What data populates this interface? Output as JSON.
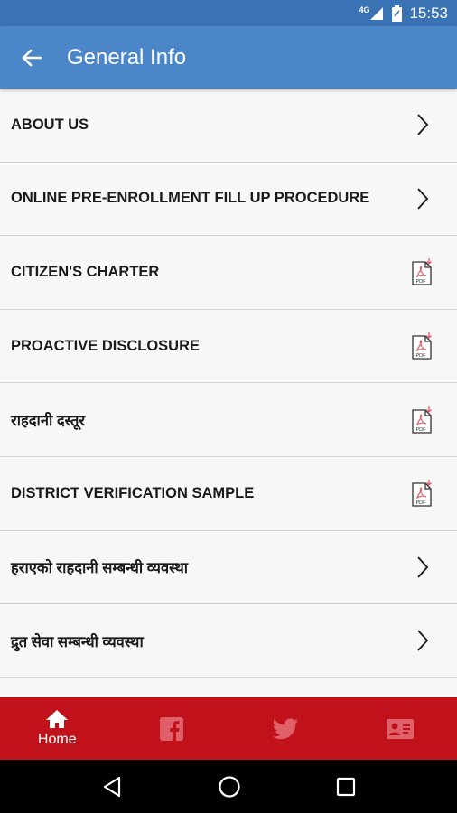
{
  "status": {
    "network": "4G",
    "time": "15:53"
  },
  "appbar": {
    "title": "General Info"
  },
  "items": [
    {
      "label": "ABOUT US",
      "icon": "chevron-right-icon"
    },
    {
      "label": "ONLINE PRE-ENROLLMENT FILL UP PROCEDURE",
      "icon": "chevron-right-icon"
    },
    {
      "label": "CITIZEN'S CHARTER",
      "icon": "pdf-icon"
    },
    {
      "label": "PROACTIVE DISCLOSURE",
      "icon": "pdf-icon"
    },
    {
      "label": "राहदानी दस्तूर",
      "icon": "pdf-icon"
    },
    {
      "label": "DISTRICT VERIFICATION SAMPLE",
      "icon": "pdf-icon"
    },
    {
      "label": "हराएको राहदानी सम्बन्धी व्यवस्था",
      "icon": "chevron-right-icon"
    },
    {
      "label": "द्रुत सेवा सम्बन्धी व्यवस्था",
      "icon": "chevron-right-icon"
    }
  ],
  "pdf_text": "PDF",
  "bottom_nav": {
    "home_label": "Home"
  },
  "colors": {
    "status_bar": "#3a73b4",
    "app_bar": "#4a86c8",
    "bottom_nav": "#c1121b",
    "icon_accent": "#e0606a"
  }
}
